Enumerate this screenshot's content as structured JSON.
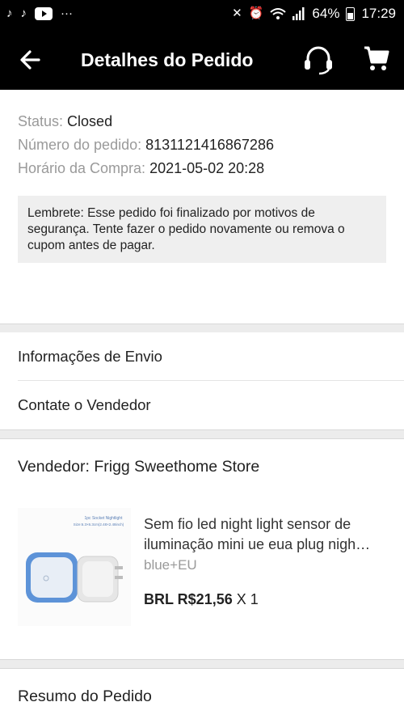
{
  "status_bar": {
    "battery": "64%",
    "time": "17:29",
    "icons": [
      "tiktok-icon",
      "tiktok-icon",
      "youtube-icon",
      "more-dots-icon",
      "mute-icon",
      "alarm-icon",
      "wifi-icon",
      "signal-icon",
      "battery-icon"
    ]
  },
  "header": {
    "title": "Detalhes do Pedido",
    "icons": [
      "back-arrow-icon",
      "headset-icon",
      "cart-icon"
    ]
  },
  "order": {
    "status_label": "Status:",
    "status_value": "Closed",
    "number_label": "Número do pedido:",
    "number_value": "8131121416867286",
    "time_label": "Horário da Compra:",
    "time_value": "2021-05-02 20:28",
    "reminder": "Lembrete: Esse pedido foi finalizado por motivos de segurança. Tente fazer o pedido novamente ou remova o cupom antes de pagar."
  },
  "links": {
    "shipping": "Informações de Envio",
    "contact": "Contate o Vendedor"
  },
  "seller": {
    "label": "Vendedor: Frigg Sweethome Store"
  },
  "product": {
    "image_caption_1": "1pc Socket Nightlight",
    "image_caption_2": "Size:6.3×6.3cm(2.48×2.48inch)",
    "title": "Sem fio led night light sensor de iluminação mini ue eua plug nigh…",
    "variant": "blue+EU",
    "price": "BRL R$21,56",
    "quantity": "X 1"
  },
  "summary": {
    "title": "Resumo do Pedido"
  },
  "colors": {
    "header_bg": "#000000",
    "label_gray": "#9a9a9a",
    "reminder_bg": "#efefef",
    "divider": "#ececec"
  }
}
